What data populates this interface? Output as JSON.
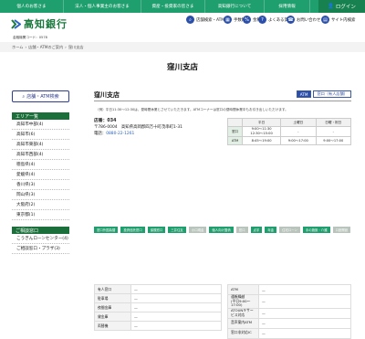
{
  "topnav": {
    "items": [
      "個人のお客さま",
      "法人・個人事業主のお客さま",
      "資産・投資家の皆さま",
      "高知銀行について",
      "採用情報"
    ],
    "login": "ログイン"
  },
  "header": {
    "logo_text": "高知銀行",
    "bank_code": "金融機関コード：0578",
    "nav": [
      {
        "icon": "search-icon",
        "label": "店舗検索・ATM"
      },
      {
        "icon": "calendar-icon",
        "label": "手数料"
      },
      {
        "icon": "percent-icon",
        "label": "金利"
      },
      {
        "icon": "question-icon",
        "label": "よくある質問"
      },
      {
        "icon": "phone-icon",
        "label": "お問い合わせ"
      },
      {
        "icon": "sitemap-icon",
        "label": "サイト内検索"
      }
    ]
  },
  "breadcrumb": [
    "ホーム",
    "店舗・ATMのご案内",
    "窪川支店"
  ],
  "page_title": "窪川支店",
  "sidebar": {
    "search_button": "店舗・ATM検索",
    "area_heading": "エリア一覧",
    "areas": [
      "高知市中部(4)",
      "高知市(6)",
      "高知市東部(4)",
      "高知市西部(4)",
      "徳島県(4)",
      "愛媛県(4)",
      "香川県(3)",
      "岡山県(3)",
      "大阪府(2)",
      "東京都(1)"
    ],
    "consult_heading": "ご相談窓口",
    "consult": [
      "こうぎんローンセンター(4)",
      "ご相談窓口・プラザ(3)"
    ]
  },
  "branch": {
    "name": "窪川支店",
    "tags": [
      "ATM",
      "窓口（有人店舗）"
    ],
    "notice": "（例）平日11:30～12:30は、昼時間休業とさせていただきます。ATMコーナーは窓口の昼時間休業中もお引き出しいただけます。",
    "code_label": "店番：034",
    "address": "〒786-0004　高知県高岡郡四万十町茂串町1-31",
    "tel_label": "電話：",
    "tel": "0880-22-1261"
  },
  "hours": {
    "headers": [
      "",
      "",
      "平日",
      "土曜日",
      "日曜・祝日"
    ],
    "rows": [
      {
        "label": "窓口",
        "time": "9:00～11:30\n12:30～15:00",
        "sat": "-",
        "sun": "-"
      },
      {
        "label": "ATM",
        "time": "8:45～19:00",
        "sat": "9:00～17:00",
        "sun": "9:00～17:00"
      }
    ]
  },
  "services": [
    {
      "label": "窓口外国為替",
      "on": true
    },
    {
      "label": "投資信託窓口",
      "on": true
    },
    {
      "label": "保険窓口",
      "on": true
    },
    {
      "label": "三井住友",
      "on": true
    },
    {
      "label": "小口現金",
      "on": false
    },
    {
      "label": "個人向け国債",
      "on": true
    },
    {
      "label": "窓口",
      "on": false
    },
    {
      "label": "点字",
      "on": true
    },
    {
      "label": "年金",
      "on": true
    },
    {
      "label": "住宅ローン",
      "on": false
    },
    {
      "label": "手の施設・介護",
      "on": true
    },
    {
      "label": "口座開設",
      "on": false
    }
  ],
  "details_left": [
    {
      "label": "有人窓口",
      "value": "—"
    },
    {
      "label": "駐車場",
      "value": "—"
    },
    {
      "label": "夜間金庫",
      "value": "—"
    },
    {
      "label": "貸金庫",
      "value": "—"
    },
    {
      "label": "両替機",
      "value": "—"
    }
  ],
  "details_right": [
    {
      "label": "ATM",
      "value": "—"
    },
    {
      "label": "通帳繰越\n(平日9:00～17:00)",
      "value": "—"
    },
    {
      "label": "ATOUNキサービス対応",
      "value": "—"
    },
    {
      "label": "音声案内ATM",
      "value": "—"
    },
    {
      "label": "窓口非対応IC",
      "value": "—"
    }
  ]
}
